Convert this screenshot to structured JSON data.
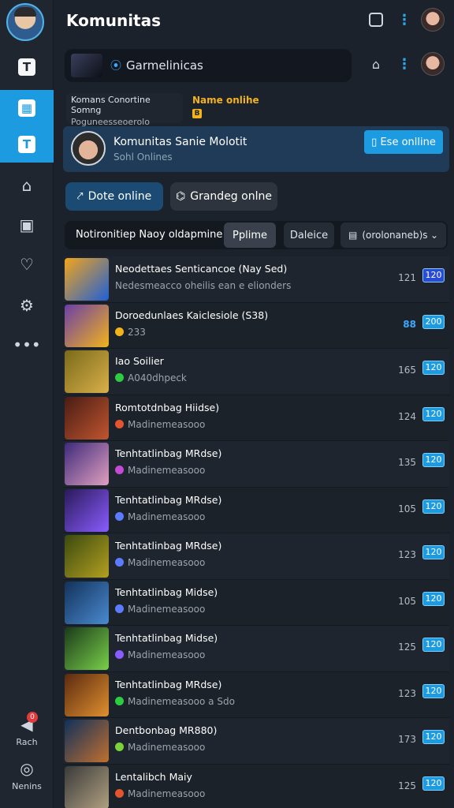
{
  "header": {
    "title": "Komunitas"
  },
  "sidebar": {
    "bottom": [
      {
        "label": "Rach",
        "badge": "0"
      },
      {
        "label": "Nenins"
      }
    ]
  },
  "search": {
    "value": "Garmelinicas"
  },
  "status": {
    "left_title": "Komans Conortine Somng",
    "left_sub": "Poguneesseoerolo",
    "right_title": "Name onlihe",
    "right_badge": "B"
  },
  "profile": {
    "name": "Komunitas Sanie Molotit",
    "sub": "Sohl Onlines",
    "button": "Ese onlline"
  },
  "actions": {
    "primary": "Dote online",
    "secondary": "Grandeg onlne"
  },
  "filters": {
    "label": "Notironitiep Naoy oldapmine",
    "tab_selected": "Pplime",
    "tab_other": "Daleice",
    "select": "(orolonaneb)s"
  },
  "colors": {
    "accent": "#1d9be0",
    "background": "#1c222b",
    "sidebar": "#20262f",
    "status_yellow": "#f2b31b"
  },
  "games": [
    {
      "title": "Neodettaes Senticancoe (Nay Sed)",
      "sub": "Nedesmeacco oheilis ean e elionders",
      "count": "121",
      "badge": "120",
      "dot": "",
      "count_blue": false,
      "deep": true
    },
    {
      "title": "Doroedunlaes Kaiclesiole (S38)",
      "sub": "233",
      "count": "88",
      "badge": "200",
      "dot": "#f2b31b",
      "count_blue": true,
      "deep": false
    },
    {
      "title": "Iao Soilier",
      "sub": "A040dhpeck",
      "count": "165",
      "badge": "120",
      "dot": "#2ecc40",
      "count_blue": false,
      "deep": false
    },
    {
      "title": "Romtotdnbag Hiidse)",
      "sub": "Madinemeasooo",
      "count": "124",
      "badge": "120",
      "dot": "#e2552f",
      "count_blue": false,
      "deep": false
    },
    {
      "title": "Tenhtatlinbag MRdse)",
      "sub": "Madinemeasooo",
      "count": "135",
      "badge": "120",
      "dot": "#c34bd6",
      "count_blue": false,
      "deep": false
    },
    {
      "title": "Tenhtatlinbag MRdse)",
      "sub": "Madinemeasooo",
      "count": "105",
      "badge": "120",
      "dot": "#5c7cff",
      "count_blue": false,
      "deep": false
    },
    {
      "title": "Tenhtatlinbag MRdse)",
      "sub": "Madinemeasooo",
      "count": "123",
      "badge": "120",
      "dot": "#5c7cff",
      "count_blue": false,
      "deep": false
    },
    {
      "title": "Tenhtatlinbag Midse)",
      "sub": "Madinemeasooo",
      "count": "105",
      "badge": "120",
      "dot": "#5c7cff",
      "count_blue": false,
      "deep": false
    },
    {
      "title": "Tenhtatlinbag Midse)",
      "sub": "Madinemeasooo",
      "count": "125",
      "badge": "120",
      "dot": "#8a5cff",
      "count_blue": false,
      "deep": false
    },
    {
      "title": "Tenhtatlinbag MRdse)",
      "sub": "Madinemeasooo a Sdo",
      "count": "123",
      "badge": "120",
      "dot": "#2ecc40",
      "count_blue": false,
      "deep": false
    },
    {
      "title": "Dentbonbag MR880)",
      "sub": "Madinemeasooo",
      "count": "173",
      "badge": "120",
      "dot": "#7bd23a",
      "count_blue": false,
      "deep": false
    },
    {
      "title": "Lentalibch Maiy",
      "sub": "Madinemeasooo",
      "count": "125",
      "badge": "120",
      "dot": "#e2552f",
      "count_blue": false,
      "deep": false
    }
  ]
}
